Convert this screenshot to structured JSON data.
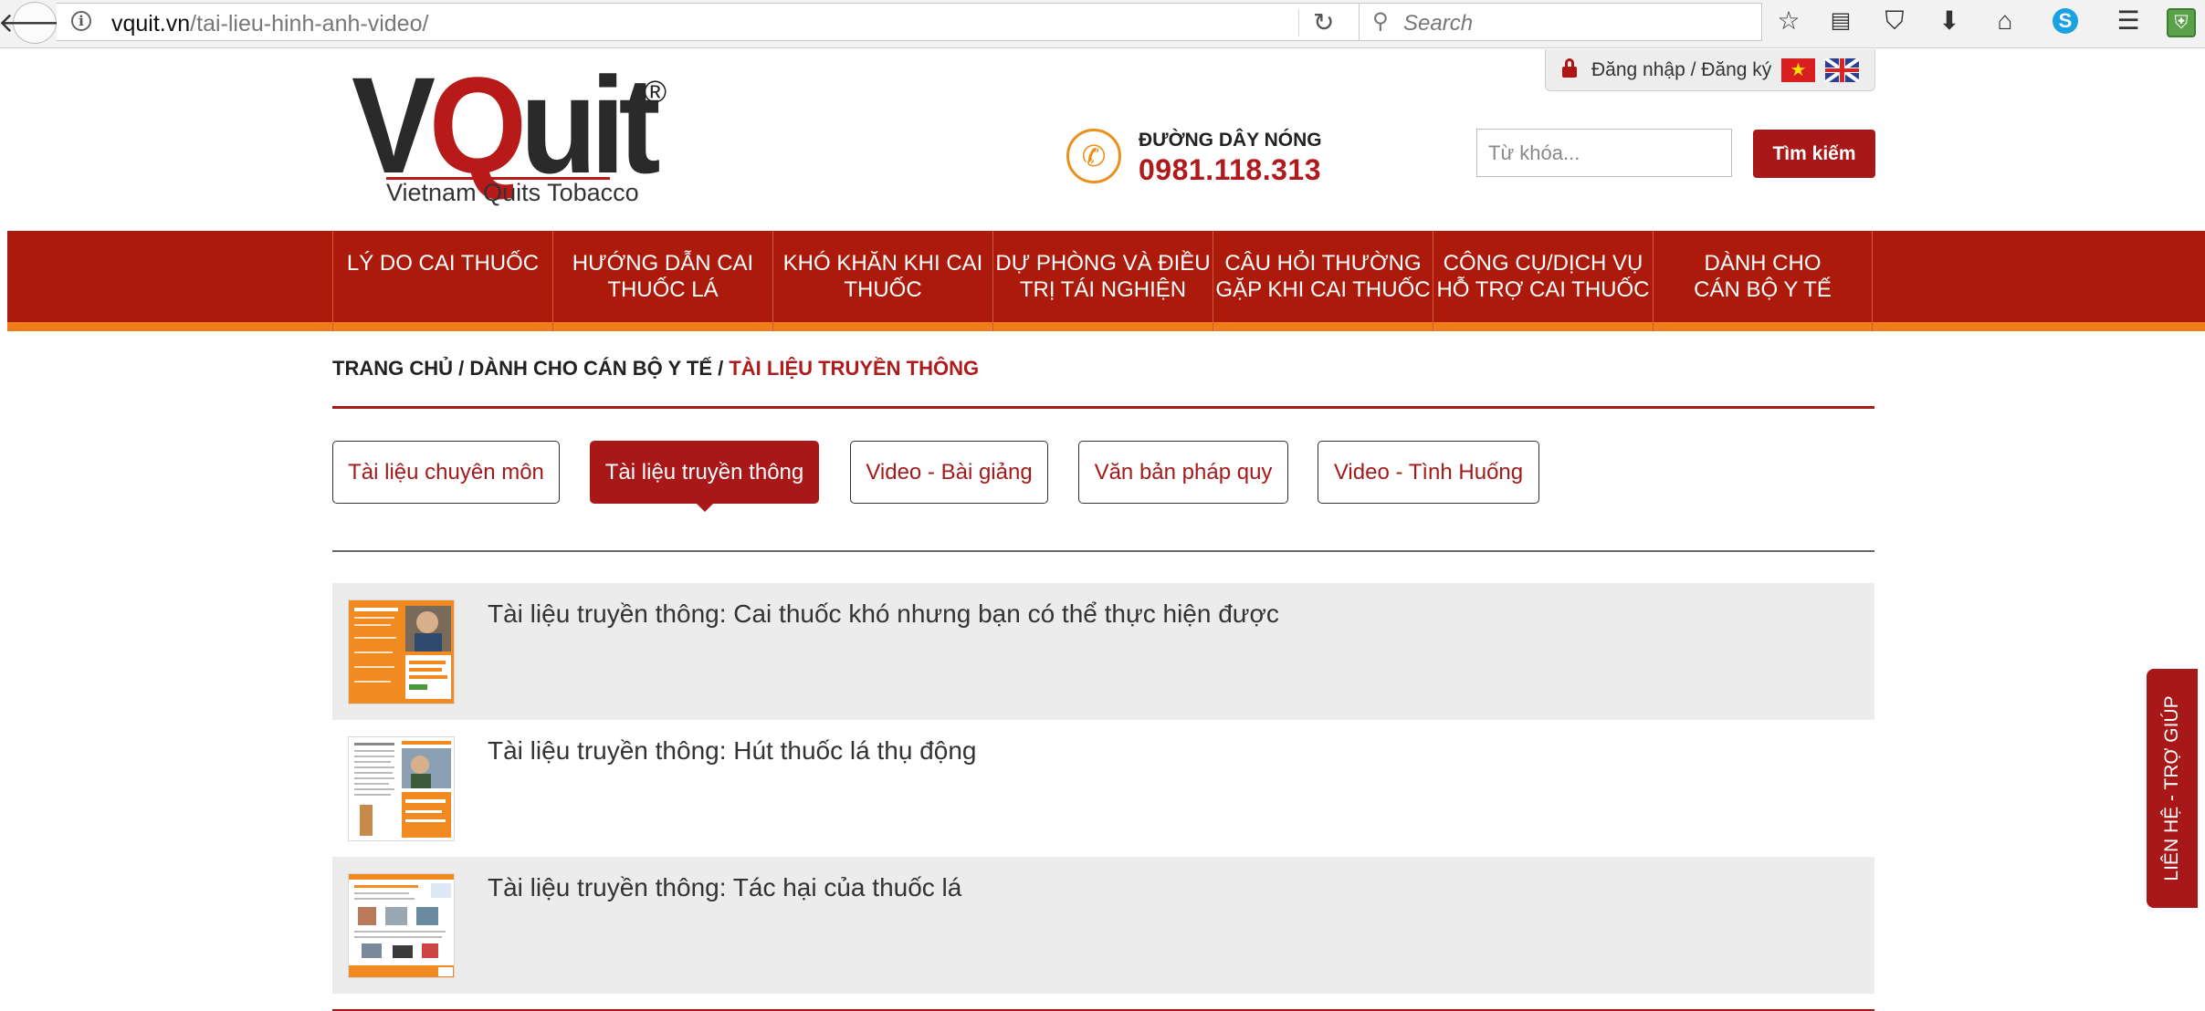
{
  "browser": {
    "url_domain": "vquit.vn",
    "url_path": "/tai-lieu-hinh-anh-video/",
    "search_placeholder": "Search",
    "icons": [
      "back-icon",
      "info-icon",
      "reload-icon",
      "search-icon",
      "bookmark-star-icon",
      "reading-list-icon",
      "pocket-icon",
      "download-icon",
      "home-icon",
      "skype-icon",
      "menu-icon",
      "extension-icon"
    ]
  },
  "header": {
    "login_text": "Đăng nhập / Đăng ký",
    "logo_text": "VQuit",
    "logo_registered": "®",
    "logo_tagline": "Vietnam Quits Tobacco",
    "hotline_label": "ĐƯỜNG DÂY NÓNG",
    "hotline_number": "0981.118.313",
    "search_placeholder": "Từ khóa...",
    "search_button": "Tìm kiếm"
  },
  "nav": [
    {
      "line1": "LÝ DO CAI THUỐC",
      "line2": ""
    },
    {
      "line1": "HƯỚNG DẪN CAI",
      "line2": "THUỐC LÁ"
    },
    {
      "line1": "KHÓ KHĂN KHI CAI",
      "line2": "THUỐC"
    },
    {
      "line1": "DỰ PHÒNG VÀ ĐIỀU",
      "line2": "TRỊ TÁI NGHIỆN"
    },
    {
      "line1": "CÂU HỎI THƯỜNG",
      "line2": "GẶP KHI CAI THUỐC"
    },
    {
      "line1": "CÔNG CỤ/DỊCH VỤ",
      "line2": "HỖ TRỢ CAI THUỐC"
    },
    {
      "line1": "DÀNH CHO",
      "line2": "CÁN BỘ Y TẾ"
    }
  ],
  "breadcrumb": {
    "home": "TRANG CHỦ",
    "parent": "DÀNH CHO CÁN BỘ Y TẾ",
    "current": "TÀI LIỆU TRUYỀN THÔNG",
    "separator": " / "
  },
  "tabs": [
    {
      "label": "Tài liệu chuyên môn",
      "active": false
    },
    {
      "label": "Tài liệu truyền thông",
      "active": true
    },
    {
      "label": "Video - Bài giảng",
      "active": false
    },
    {
      "label": "Văn bản pháp quy",
      "active": false
    },
    {
      "label": "Video - Tình Huống",
      "active": false
    }
  ],
  "items": [
    {
      "title": "Tài liệu truyền thông: Cai thuốc khó nhưng bạn có thể thực hiện được"
    },
    {
      "title": "Tài liệu truyền thông: Hút thuốc lá thụ động"
    },
    {
      "title": "Tài liệu truyền thông: Tác hại của thuốc lá"
    }
  ],
  "help_tab": "LIÊN HỆ - TRỢ GIÚP",
  "colors": {
    "brand_red": "#a81818",
    "nav_red": "#ab1a0a",
    "accent_orange": "#ef7d1a",
    "list_shade": "#ececec"
  }
}
